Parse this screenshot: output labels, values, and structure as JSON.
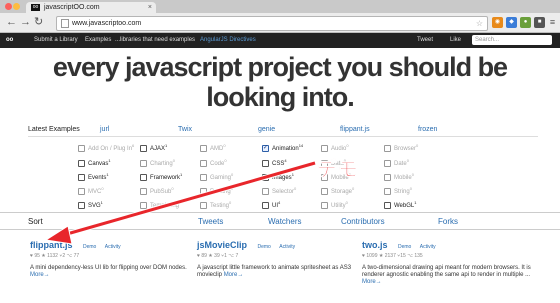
{
  "browser": {
    "tab_title": "javascriptOO.com",
    "tab_favicon": "oo",
    "url": "www.javascriptoo.com"
  },
  "navbar": {
    "logo": "oo",
    "items": [
      "Submit a Library",
      "Examples",
      "...libraries that need examples",
      "AngularJS Directives"
    ],
    "right_items": [
      "Tweet",
      "Like"
    ],
    "search_placeholder": "Search..."
  },
  "hero": {
    "line1": "every javascript project you should be",
    "line2": "looking into."
  },
  "latest_examples": {
    "label": "Latest Examples",
    "columns": [
      "jurl",
      "Twix",
      "genie",
      "flippant.js",
      "frozen"
    ]
  },
  "categories": [
    {
      "label": "Add On / Plug In",
      "count": "6",
      "active": false,
      "checked": false
    },
    {
      "label": "AJAX",
      "count": "1",
      "active": true,
      "checked": false
    },
    {
      "label": "AMD",
      "count": "0",
      "active": false,
      "checked": false
    },
    {
      "label": "Animation",
      "count": "14",
      "active": true,
      "checked": true
    },
    {
      "label": "Audio",
      "count": "0",
      "active": false,
      "checked": false
    },
    {
      "label": "Browser",
      "count": "0",
      "active": false,
      "checked": false
    },
    {
      "label": "Canvas",
      "count": "1",
      "active": true,
      "checked": false
    },
    {
      "label": "Charting",
      "count": "0",
      "active": false,
      "checked": false
    },
    {
      "label": "Code",
      "count": "0",
      "active": false,
      "checked": false
    },
    {
      "label": "CSS",
      "count": "4",
      "active": true,
      "checked": false
    },
    {
      "label": "Data",
      "count": "0",
      "active": false,
      "checked": false
    },
    {
      "label": "Date",
      "count": "0",
      "active": false,
      "checked": false
    },
    {
      "label": "Events",
      "count": "1",
      "active": true,
      "checked": false
    },
    {
      "label": "Framework",
      "count": "1",
      "active": true,
      "checked": false
    },
    {
      "label": "Gaming",
      "count": "0",
      "active": false,
      "checked": false
    },
    {
      "label": "Images",
      "count": "1",
      "active": true,
      "checked": false
    },
    {
      "label": "Mobile",
      "count": "0",
      "active": false,
      "checked": false
    },
    {
      "label": "Mobile",
      "count": "0",
      "active": false,
      "checked": false
    },
    {
      "label": "MVC",
      "count": "0",
      "active": false,
      "checked": false
    },
    {
      "label": "PubSub",
      "count": "0",
      "active": false,
      "checked": false
    },
    {
      "label": "Routing",
      "count": "0",
      "active": false,
      "checked": false
    },
    {
      "label": "Selector",
      "count": "0",
      "active": false,
      "checked": false
    },
    {
      "label": "Storage",
      "count": "0",
      "active": false,
      "checked": false
    },
    {
      "label": "String",
      "count": "0",
      "active": false,
      "checked": false
    },
    {
      "label": "SVG",
      "count": "1",
      "active": true,
      "checked": false
    },
    {
      "label": "Templating",
      "count": "0",
      "active": false,
      "checked": false
    },
    {
      "label": "Testing",
      "count": "0",
      "active": false,
      "checked": false
    },
    {
      "label": "UI",
      "count": "4",
      "active": true,
      "checked": false
    },
    {
      "label": "Utility",
      "count": "0",
      "active": false,
      "checked": false
    },
    {
      "label": "WebGL",
      "count": "1",
      "active": true,
      "checked": false
    }
  ],
  "sort": {
    "label": "Sort",
    "tabs": [
      "Tweets",
      "Watchers",
      "Contributors",
      "Forks"
    ]
  },
  "projects": [
    {
      "title": "flippant.js",
      "demo": "Demo",
      "activity": "Activity",
      "stats": "♥ 95   ★ 1132  ⑂2 ⌥ 77",
      "description": "A mini dependency-less UI lib for flipping over DOM nodes.",
      "more": "More→"
    },
    {
      "title": "jsMovieClip",
      "demo": "Demo",
      "activity": "Activity",
      "stats": "♥ 89   ★ 39  ⑂1 ⌥ 7",
      "description": "A javascript little framework to animate spritesheet as AS3 movieclip",
      "more": "More→"
    },
    {
      "title": "two.js",
      "demo": "Demo",
      "activity": "Activity",
      "stats": "♥ 1099   ★ 2137  ⑂15 ⌥ 135",
      "description": "A two-dimensional drawing api meant for modern browsers. It is renderer agnostic enabling the same api to render in multiple ...",
      "more": "More→"
    }
  ],
  "overlay": {
    "text": "デモ",
    "color": "#e8262b"
  }
}
